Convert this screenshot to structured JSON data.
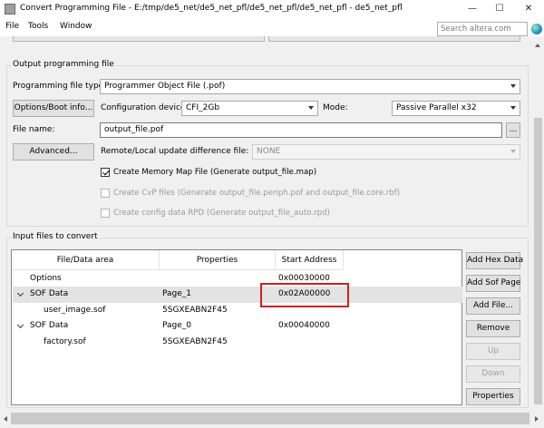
{
  "window": {
    "title": "Convert Programming File - E:/tmp/de5_net/de5_net_pfl/de5_net_pfl/de5_net_pfl - de5_net_pfl",
    "minimize": "—",
    "maximize": "☐",
    "close": "✕"
  },
  "menu": {
    "items": [
      "File",
      "Tools",
      "Window"
    ],
    "search_placeholder": "Search altera.com"
  },
  "output": {
    "group_label": "Output programming file",
    "file_type_label": "Programming file type:",
    "file_type_value": "Programmer Object File (.pof)",
    "options_button": "Options/Boot info...",
    "config_device_label": "Configuration device:",
    "config_device_value": "CFI_2Gb",
    "mode_label": "Mode:",
    "mode_value": "Passive Parallel x32",
    "file_name_label": "File name:",
    "file_name_value": "output_file.pof",
    "browse_button": "...",
    "advanced_button": "Advanced...",
    "remote_label": "Remote/Local update difference file:",
    "remote_value": "NONE",
    "checkboxes": [
      {
        "label": "Create Memory Map File (Generate output_file.map)",
        "checked": true,
        "enabled": true
      },
      {
        "label": "Create CvP files (Generate output_file.periph.pof and output_file.core.rbf)",
        "checked": false,
        "enabled": false
      },
      {
        "label": "Create config data RPD (Generate output_file_auto.rpd)",
        "checked": false,
        "enabled": false
      }
    ]
  },
  "input": {
    "group_label": "Input files to convert",
    "columns": [
      "File/Data area",
      "Properties",
      "Start Address"
    ],
    "rows": [
      {
        "name": "Options",
        "properties": "",
        "address": "0x00030000"
      },
      {
        "name": "SOF Data",
        "properties": "Page_1",
        "address": "0x02A00000"
      },
      {
        "name": "user_image.sof",
        "properties": "5SGXEABN2F45",
        "address": ""
      },
      {
        "name": "SOF Data",
        "properties": "Page_0",
        "address": "0x00040000"
      },
      {
        "name": "factory.sof",
        "properties": "5SGXEABN2F45",
        "address": ""
      }
    ],
    "buttons": {
      "add_hex": "Add Hex Data",
      "add_sof_page": "Add Sof Page",
      "add_file": "Add File...",
      "remove": "Remove",
      "up": "Up",
      "down": "Down",
      "properties": "Properties"
    }
  },
  "colors": {
    "highlight_box": "#d02020",
    "selected_row": "#e3e3e3"
  }
}
